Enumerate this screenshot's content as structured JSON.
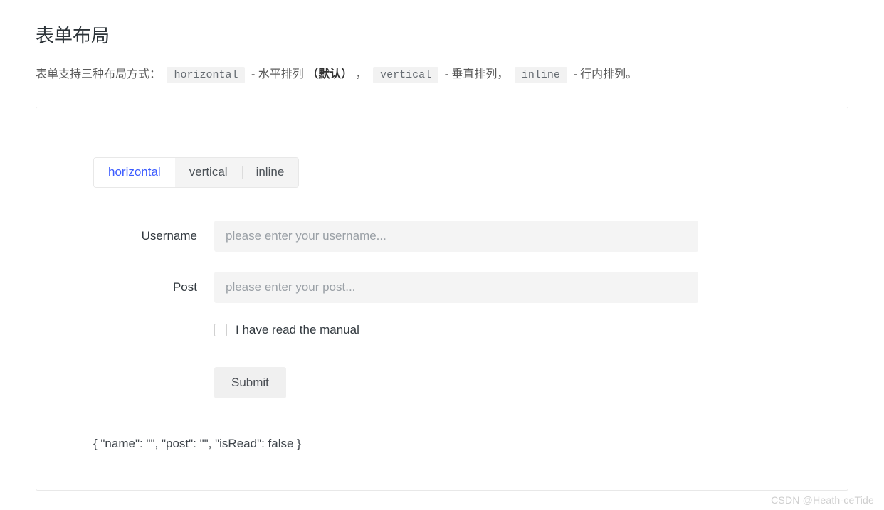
{
  "header": {
    "title": "表单布局",
    "intro_prefix": "表单支持三种布局方式：",
    "modes": [
      {
        "code": "horizontal",
        "desc": "水平排列",
        "default": true
      },
      {
        "code": "vertical",
        "desc": "垂直排列",
        "default": false
      },
      {
        "code": "inline",
        "desc": "行内排列。",
        "default": false
      }
    ],
    "default_marker": "（默认）",
    "separator_dash": " - ",
    "separator_comma": "，"
  },
  "demo": {
    "radio": {
      "options": [
        "horizontal",
        "vertical",
        "inline"
      ],
      "active_index": 0
    },
    "fields": {
      "username": {
        "label": "Username",
        "placeholder": "please enter your username...",
        "value": ""
      },
      "post": {
        "label": "Post",
        "placeholder": "please enter your post...",
        "value": ""
      },
      "isRead": {
        "label": "I have read the manual",
        "checked": false
      }
    },
    "submit_label": "Submit",
    "state_dump": "{ \"name\": \"\", \"post\": \"\", \"isRead\": false }"
  },
  "watermark": "CSDN @Heath-ceTide"
}
